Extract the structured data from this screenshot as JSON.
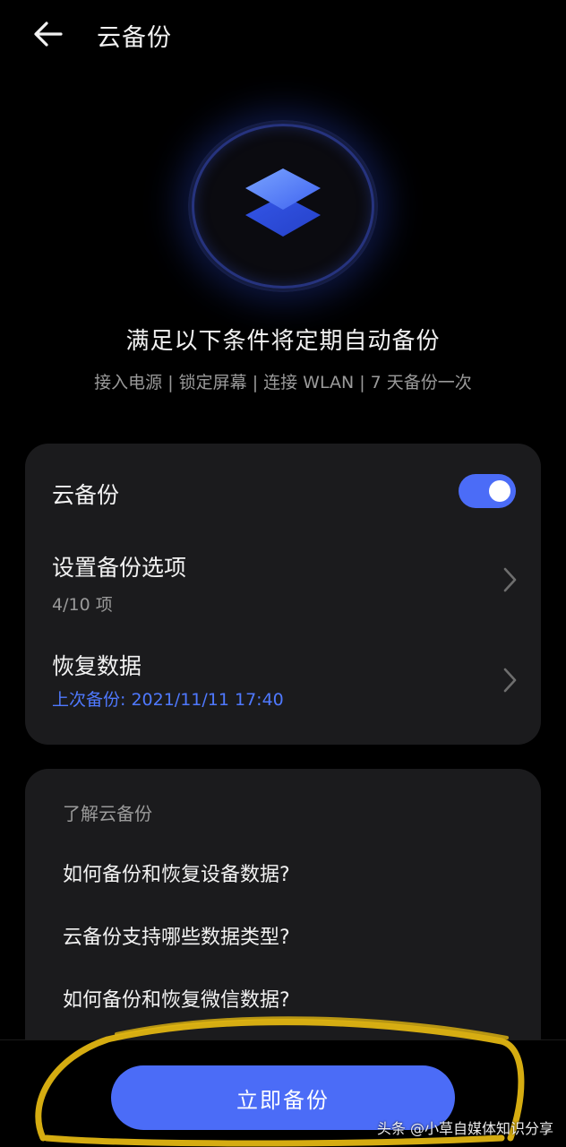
{
  "header": {
    "title": "云备份"
  },
  "hero": {
    "headline": "满足以下条件将定期自动备份",
    "conditions": "接入电源 | 锁定屏幕 | 连接 WLAN | 7 天备份一次"
  },
  "settings": {
    "cloud_backup": {
      "label": "云备份",
      "enabled": true
    },
    "backup_options": {
      "label": "设置备份选项",
      "sub": "4/10 项"
    },
    "restore_data": {
      "label": "恢复数据",
      "sub": "上次备份: 2021/11/11 17:40"
    }
  },
  "learn": {
    "title": "了解云备份",
    "faqs": [
      "如何备份和恢复设备数据?",
      "云备份支持哪些数据类型?",
      "如何备份和恢复微信数据?"
    ]
  },
  "bottom": {
    "button_label": "立即备份"
  },
  "watermark": "头条 @小草自媒体知识分享",
  "colors": {
    "accent": "#4b6cf7",
    "link_blue": "#4f79ff",
    "card_bg": "#1b1b1d",
    "highlight": "#e0b512"
  }
}
